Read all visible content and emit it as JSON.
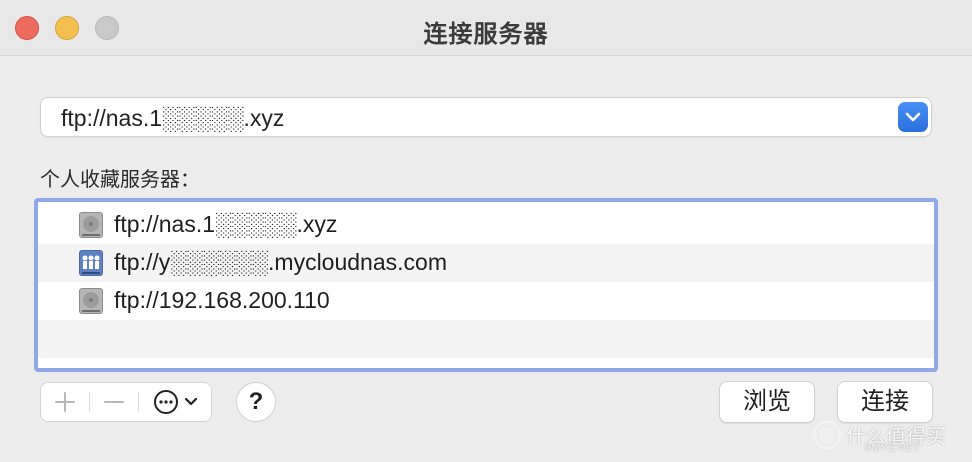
{
  "window": {
    "title": "连接服务器"
  },
  "address": {
    "value": "ftp://nas.1░░░░░.xyz"
  },
  "favorites": {
    "label": "个人收藏服务器：",
    "items": [
      {
        "label": "ftp://nas.1░░░░░.xyz",
        "icon": "hard-drive-icon"
      },
      {
        "label": "ftp://y░░░░░░.mycloudnas.com",
        "icon": "network-server-icon"
      },
      {
        "label": "ftp://192.168.200.110",
        "icon": "hard-drive-icon"
      }
    ]
  },
  "toolbar": {
    "add_label": "+",
    "remove_label": "−",
    "help_label": "?"
  },
  "buttons": {
    "browse": "浏览",
    "connect": "连接"
  },
  "watermark": {
    "text": "什么值得买",
    "sub": "SMYZ.NET"
  },
  "colors": {
    "accent": "#2b6fe0",
    "list_focus": "#8fa9e6",
    "close": "#ec6a5e",
    "minimize": "#f4bf4f"
  }
}
